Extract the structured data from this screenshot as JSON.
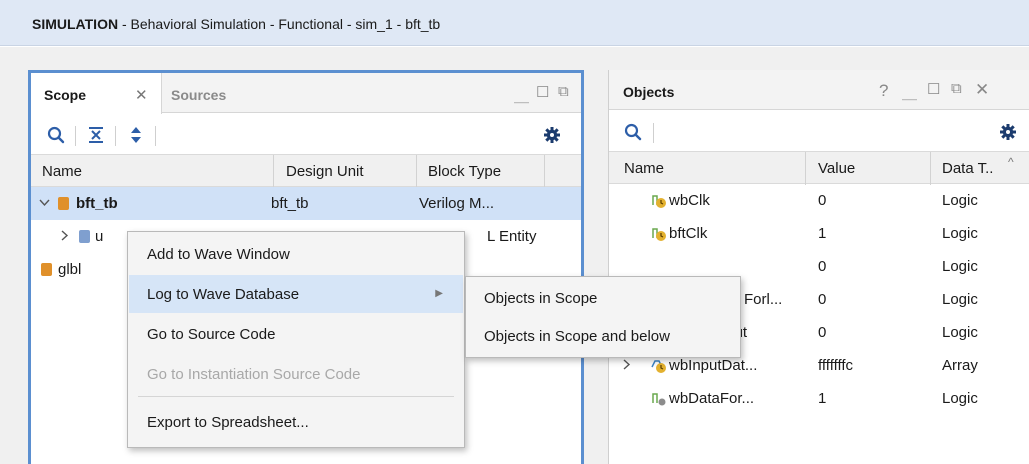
{
  "header": {
    "bold": "SIMULATION",
    "rest": " - Behavioral Simulation - Functional - sim_1 - bft_tb"
  },
  "scope": {
    "tabs": {
      "scope": "Scope",
      "sources": "Sources"
    },
    "columns": {
      "name": "Name",
      "design_unit": "Design Unit",
      "block_type": "Block Type"
    },
    "rows": [
      {
        "name": "bft_tb",
        "design_unit": "bft_tb",
        "block_type": "Verilog M..."
      },
      {
        "name": "u",
        "design_unit": "",
        "block_type": "L Entity"
      },
      {
        "name": "glbl",
        "design_unit": "",
        "block_type": ""
      }
    ]
  },
  "objects": {
    "title": "Objects",
    "help": "?",
    "columns": {
      "name": "Name",
      "value": "Value",
      "data_type": "Data T.."
    },
    "rows": [
      {
        "name": "wbClk",
        "value": "0",
        "type": "Logic"
      },
      {
        "name": "bftClk",
        "value": "1",
        "type": "Logic"
      },
      {
        "name": "",
        "value": "0",
        "type": "Logic"
      },
      {
        "name": "Forl...",
        "value": "0",
        "type": "Logic"
      },
      {
        "name": "wbWriteOut",
        "value": "0",
        "type": "Logic"
      },
      {
        "name": "wbInputDat...",
        "value": "fffffffc",
        "type": "Array"
      },
      {
        "name": "wbDataFor...",
        "value": "1",
        "type": "Logic"
      }
    ]
  },
  "context_menu": {
    "items": [
      {
        "label": "Add to Wave Window"
      },
      {
        "label": "Log to Wave Database"
      },
      {
        "label": "Go to Source Code"
      },
      {
        "label": "Go to Instantiation Source Code"
      },
      {
        "label": "Export to Spreadsheet..."
      }
    ]
  },
  "submenu": {
    "items": [
      {
        "label": "Objects in Scope"
      },
      {
        "label": "Objects in Scope and below"
      }
    ]
  },
  "colors": {
    "accent": "#5b8fd0",
    "selection": "#d0e1f7",
    "icon_blue": "#2d5ea8",
    "cube_orange": "#e0902a"
  }
}
